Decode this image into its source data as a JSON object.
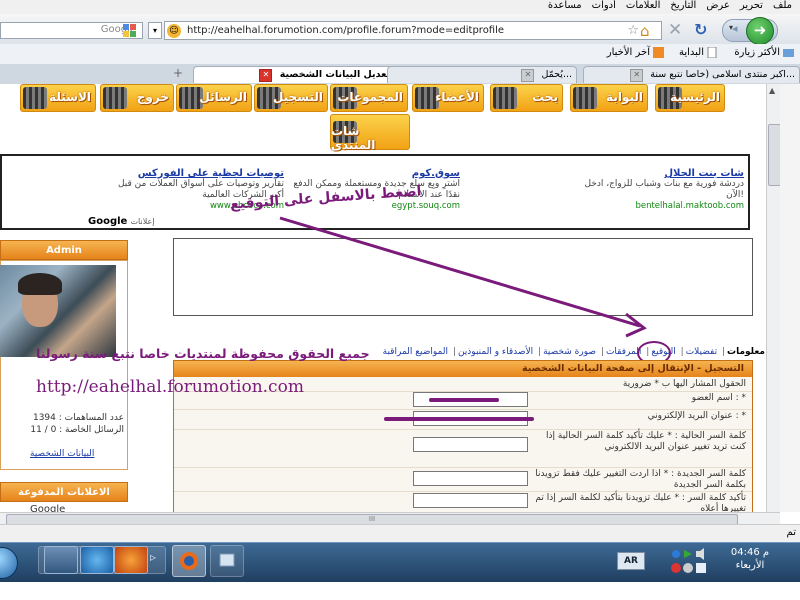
{
  "menu": [
    "ملف",
    "تحرير",
    "عرض",
    "التاريخ",
    "العلامات",
    "أدوات",
    "مساعدة"
  ],
  "browser": {
    "url": "http://eahelhal.forumotion.com/profile.forum?mode=editprofile",
    "search_placeholder": "Google"
  },
  "bookmarks": [
    "الأكثر زيارة",
    "البداية",
    "آخر الأخبار"
  ],
  "tabs": [
    {
      "title": "تعديل البيانات الشخصية",
      "active": true
    },
    {
      "title": "يُحمّل...",
      "active": false
    },
    {
      "title": "اكبر منتدى اسلامى (خاصا نتبع سنة...",
      "active": false
    }
  ],
  "forum_nav": [
    "الرئيسية",
    "البوابة",
    "بحث",
    "الأعضاء",
    "المجموعات",
    "التسجيل",
    "الرسائل",
    "خروج",
    "الاسئلة"
  ],
  "forum_nav_extra": "شات المنتدى",
  "ads": [
    {
      "title": "شات بنت الحلال",
      "body": "دردشة فورية مع بنات وشباب للزواج، ادخل الآن!",
      "url": "bentelhalal.maktoob.com"
    },
    {
      "title": "سوق.كوم",
      "body": "اشترِ وبِع سلع جديدة ومستعملة وممكن الدفع نقدًا عند الاستلام",
      "url": "egypt.souq.com"
    },
    {
      "title": "توصيات لحظية على الفوركس",
      "body": "تقارير وتوصيات على أسواق العملات من قبل أكبر الشركات العالمية",
      "url": "www.ebcoca.com"
    }
  ],
  "google_ads_label": "Google",
  "ads_word": "إعلانات",
  "side": {
    "header": "Admin",
    "stats": [
      "عدد المساهمات : 1394",
      "الرسائل الخاصة : 0 / 11"
    ],
    "link": "البيانات الشخصية",
    "header2": "الاعلانات المدفوعة",
    "google": "Google"
  },
  "profile_tabs": [
    "معلومات",
    "تفضيلات",
    "التوقيع",
    "المرفقات",
    "صورة شخصية",
    "الأصدقاء و المنبوذين",
    "المواضيع المراقبة"
  ],
  "form": {
    "header": "التسجيل - الإنتقال إلى صفحة البيانات الشخصية",
    "required_note": "الحقول المشار اليها ب * ضرورية",
    "rows": [
      {
        "label": "اسم العضو : *",
        "scribbled": true
      },
      {
        "label": "عنوان البريد الإلكتروني : *",
        "scribbled": true
      },
      {
        "label": "كلمة السر الحالية : * عليك تأكيد كلمة السر الحالية إذا كنت تريد تغيير عنوان البريد الالكتروني",
        "scribbled": false
      },
      {
        "label": "كلمة السر الجديدة : * اذا اردت التغيير عليك فقط تزويدنا بكلمة السر الجديدة",
        "scribbled": false
      },
      {
        "label": "تأكيد كلمة السر : * عليك تزويدنا بتأكيد لكلمة السر إذا تم تغييرها أعلاه",
        "scribbled": false
      }
    ]
  },
  "annotations": {
    "arrow_text": "اضغط بالاسفل على التوقيع",
    "watermark": "جميع الحقوق محفوظة لمنتديات خاصا نتبع سنة رسولنا",
    "url": "http://eahelhal.forumotion.com"
  },
  "status": {
    "done": "تم"
  },
  "taskbar": {
    "lang": "AR",
    "time": "04:46 م",
    "day": "الأربعاء"
  },
  "colors": {
    "accent_orange": "#f2a215",
    "annotation_purple": "#7a1a7a",
    "link_blue": "#1b3aa6"
  }
}
